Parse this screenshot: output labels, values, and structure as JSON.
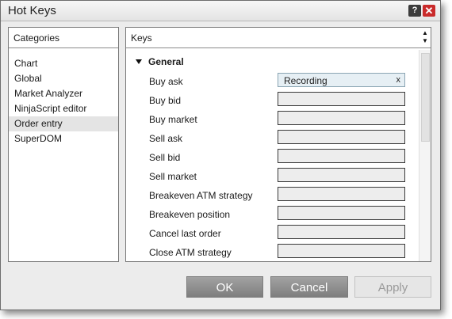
{
  "window": {
    "title": "Hot Keys"
  },
  "titlebar": {
    "help_glyph": "?",
    "close_glyph": "✕"
  },
  "categories": {
    "header": "Categories",
    "items": [
      "Chart",
      "Global",
      "Market Analyzer",
      "NinjaScript editor",
      "Order entry",
      "SuperDOM"
    ],
    "selected": "Order entry"
  },
  "keys": {
    "header": "Keys",
    "group": "General",
    "rows": [
      {
        "label": "Buy ask",
        "value": "Recording",
        "clear": "x"
      },
      {
        "label": "Buy bid",
        "value": ""
      },
      {
        "label": "Buy market",
        "value": ""
      },
      {
        "label": "Sell ask",
        "value": ""
      },
      {
        "label": "Sell bid",
        "value": ""
      },
      {
        "label": "Sell market",
        "value": ""
      },
      {
        "label": "Breakeven ATM strategy",
        "value": ""
      },
      {
        "label": "Breakeven position",
        "value": ""
      },
      {
        "label": "Cancel last order",
        "value": ""
      },
      {
        "label": "Close ATM strategy",
        "value": ""
      }
    ]
  },
  "buttons": {
    "ok": "OK",
    "cancel": "Cancel",
    "apply": "Apply"
  }
}
